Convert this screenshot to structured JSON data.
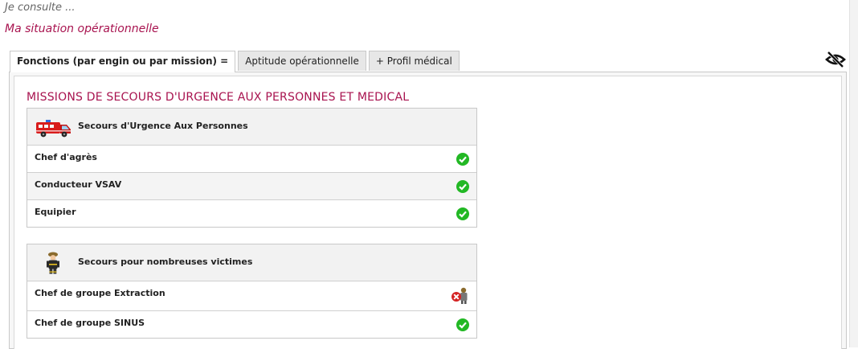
{
  "header": {
    "kicker": "Je consulte ...",
    "title": "Ma situation opérationnelle"
  },
  "tabs": [
    {
      "label": "Fonctions (par engin ou par mission) =",
      "active": true
    },
    {
      "label": "Aptitude opérationnelle",
      "active": false
    },
    {
      "label": "+ Profil médical",
      "active": false
    }
  ],
  "toolbar": {
    "visibility_icon": "eye-slash-icon"
  },
  "section": {
    "title": "MISSIONS DE SECOURS D'URGENCE AUX PERSONNES ET MEDICAL"
  },
  "missions": [
    {
      "label": "Secours d'Urgence Aux Personnes",
      "icon": "fire-ambulance-icon",
      "functions": [
        {
          "label": "Chef d'agrès",
          "status": "ok"
        },
        {
          "label": "Conducteur VSAV",
          "status": "ok"
        },
        {
          "label": "Equipier",
          "status": "ok"
        }
      ]
    },
    {
      "label": "Secours pour nombreuses victimes",
      "icon": "firefighter-icon",
      "functions": [
        {
          "label": "Chef de groupe Extraction",
          "status": "not-qualified"
        },
        {
          "label": "Chef de groupe SINUS",
          "status": "ok"
        }
      ]
    }
  ],
  "colors": {
    "accent": "#a8134f",
    "ok": "#22b824",
    "error": "#d42323"
  }
}
